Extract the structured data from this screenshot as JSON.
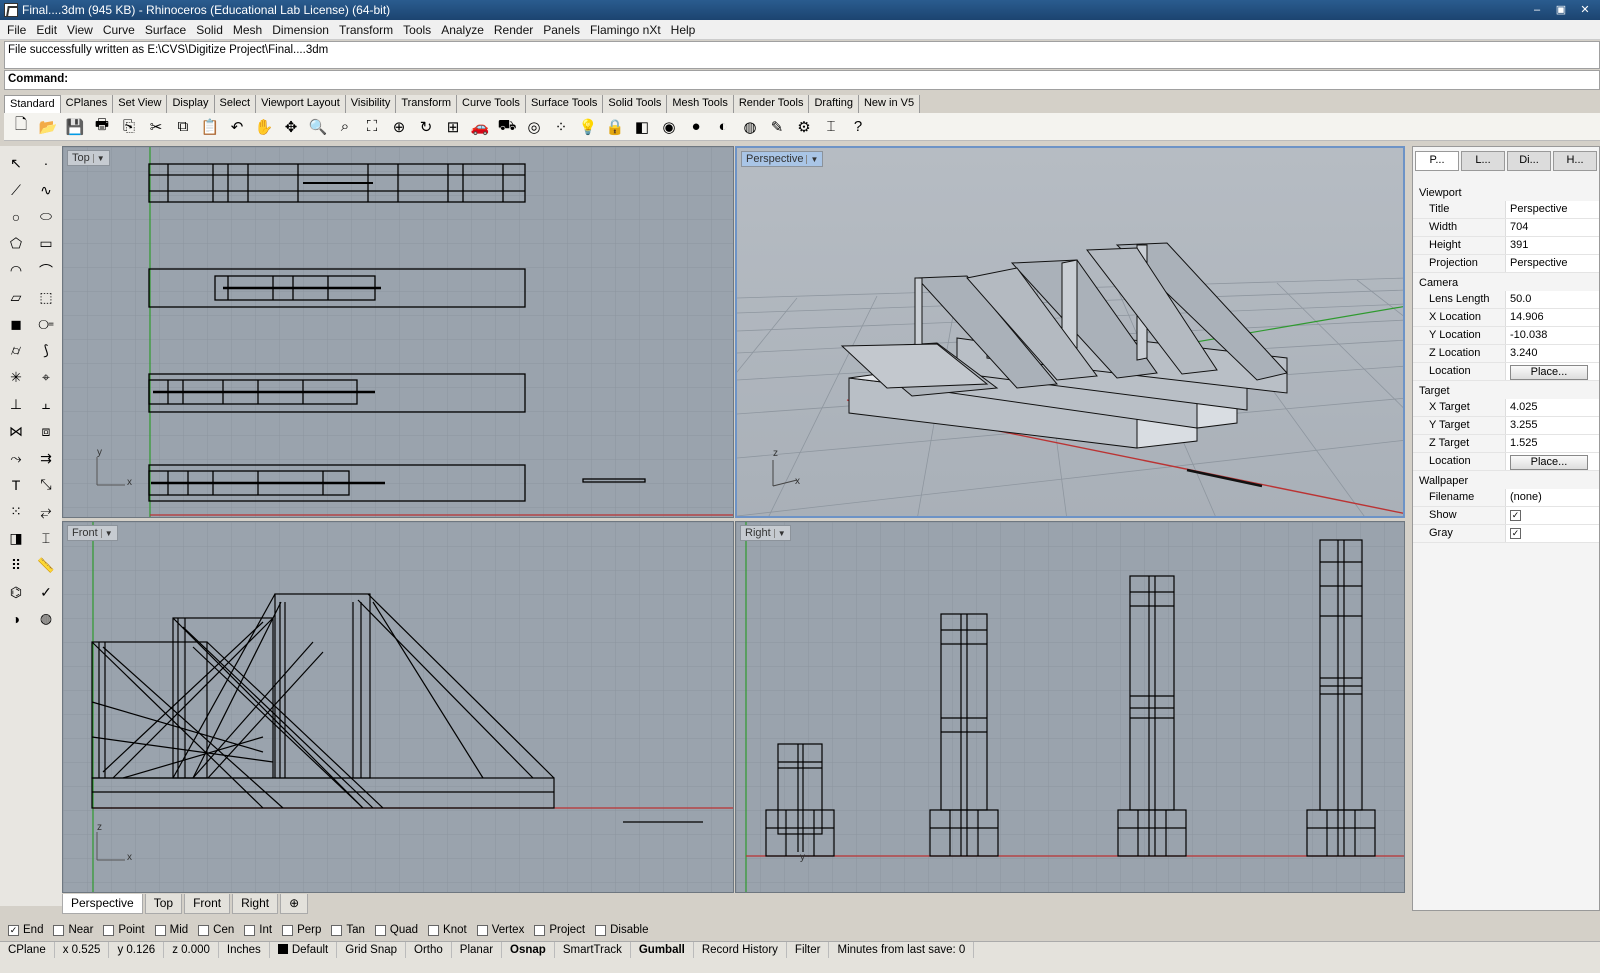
{
  "window": {
    "title": "Final....3dm (945 KB) - Rhinoceros (Educational Lab License) (64-bit)"
  },
  "menu": [
    "File",
    "Edit",
    "View",
    "Curve",
    "Surface",
    "Solid",
    "Mesh",
    "Dimension",
    "Transform",
    "Tools",
    "Analyze",
    "Render",
    "Panels",
    "Flamingo nXt",
    "Help"
  ],
  "command": {
    "history": "File successfully written as E:\\CVS\\Digitize Project\\Final....3dm",
    "prompt": "Command:",
    "value": ""
  },
  "toolbar_tabs": [
    "Standard",
    "CPlanes",
    "Set View",
    "Display",
    "Select",
    "Viewport Layout",
    "Visibility",
    "Transform",
    "Curve Tools",
    "Surface Tools",
    "Solid Tools",
    "Mesh Tools",
    "Render Tools",
    "Drafting",
    "New in V5"
  ],
  "toolbar_icons": [
    "new-file-icon",
    "open-folder-icon",
    "save-icon",
    "print-icon",
    "import-icon",
    "cut-icon",
    "copy-icon",
    "paste-icon",
    "undo-icon",
    "pan-hand-icon",
    "rotate-view-icon",
    "zoom-icon",
    "zoom-window-icon",
    "zoom-extents-icon",
    "zoom-selected-icon",
    "undo-view-icon",
    "four-viewports-icon",
    "car-icon",
    "shaded-car-icon",
    "object-snap-icon",
    "points-icon",
    "light-icon",
    "lock-icon",
    "layer-icon",
    "color-wheel-icon",
    "rendered-sphere-icon",
    "shaded-sphere-icon",
    "render-icon",
    "paint-icon",
    "settings-icon",
    "dimension-icon",
    "help-icon"
  ],
  "sidebar_icons": [
    "select-arrow-icon",
    "point-icon",
    "polyline-icon",
    "curve-icon",
    "circle-icon",
    "ellipse-icon",
    "polygon-icon",
    "rectangle-icon",
    "arc-icon",
    "fillet-icon",
    "surface-icon",
    "extrude-icon",
    "box-icon",
    "boolean-icon",
    "cylinder-icon",
    "sweep-icon",
    "explode-icon",
    "edit-point-icon",
    "trim-icon",
    "split-icon",
    "join-icon",
    "group-icon",
    "blend-icon",
    "offset-icon",
    "text-icon",
    "scale-icon",
    "array-icon",
    "flow-icon",
    "block-icon",
    "dimension-icon",
    "grid-array-icon",
    "measure-icon",
    "analyze-icon",
    "check-icon",
    "shade-icon",
    "render-icon"
  ],
  "viewports": {
    "top": {
      "label": "Top"
    },
    "perspective": {
      "label": "Perspective"
    },
    "front": {
      "label": "Front"
    },
    "right": {
      "label": "Right"
    },
    "axis": {
      "x": "x",
      "y": "y",
      "z": "z"
    }
  },
  "viewport_tabs": [
    "Perspective",
    "Top",
    "Front",
    "Right",
    "⊕"
  ],
  "osnap": [
    {
      "label": "End",
      "checked": true
    },
    {
      "label": "Near",
      "checked": false
    },
    {
      "label": "Point",
      "checked": false
    },
    {
      "label": "Mid",
      "checked": false
    },
    {
      "label": "Cen",
      "checked": false
    },
    {
      "label": "Int",
      "checked": false
    },
    {
      "label": "Perp",
      "checked": false
    },
    {
      "label": "Tan",
      "checked": false
    },
    {
      "label": "Quad",
      "checked": false
    },
    {
      "label": "Knot",
      "checked": false
    },
    {
      "label": "Vertex",
      "checked": false
    },
    {
      "label": "Project",
      "checked": false
    },
    {
      "label": "Disable",
      "checked": false
    }
  ],
  "status": {
    "cplane": "CPlane",
    "x": "x 0.525",
    "y": "y 0.126",
    "z": "z 0.000",
    "units": "Inches",
    "layer": "Default",
    "toggles": [
      "Grid Snap",
      "Ortho",
      "Planar",
      "Osnap",
      "SmartTrack",
      "Gumball",
      "Record History",
      "Filter"
    ],
    "minutes": "Minutes from last save: 0"
  },
  "properties": {
    "tabs": [
      "P...",
      "L...",
      "Di...",
      "H..."
    ],
    "viewport_header": "Viewport",
    "title_k": "Title",
    "title_v": "Perspective",
    "width_k": "Width",
    "width_v": "704",
    "height_k": "Height",
    "height_v": "391",
    "projection_k": "Projection",
    "projection_v": "Perspective",
    "camera_header": "Camera",
    "lens_k": "Lens Length",
    "lens_v": "50.0",
    "xloc_k": "X Location",
    "xloc_v": "14.906",
    "yloc_k": "Y Location",
    "yloc_v": "-10.038",
    "zloc_k": "Z Location",
    "zloc_v": "3.240",
    "loc_k": "Location",
    "place_btn": "Place...",
    "target_header": "Target",
    "xt_k": "X Target",
    "xt_v": "4.025",
    "yt_k": "Y Target",
    "yt_v": "3.255",
    "zt_k": "Z Target",
    "zt_v": "1.525",
    "loc2_k": "Location",
    "wallpaper_header": "Wallpaper",
    "filename_k": "Filename",
    "filename_v": "(none)",
    "show_k": "Show",
    "show_checked": true,
    "gray_k": "Gray",
    "gray_checked": true
  }
}
